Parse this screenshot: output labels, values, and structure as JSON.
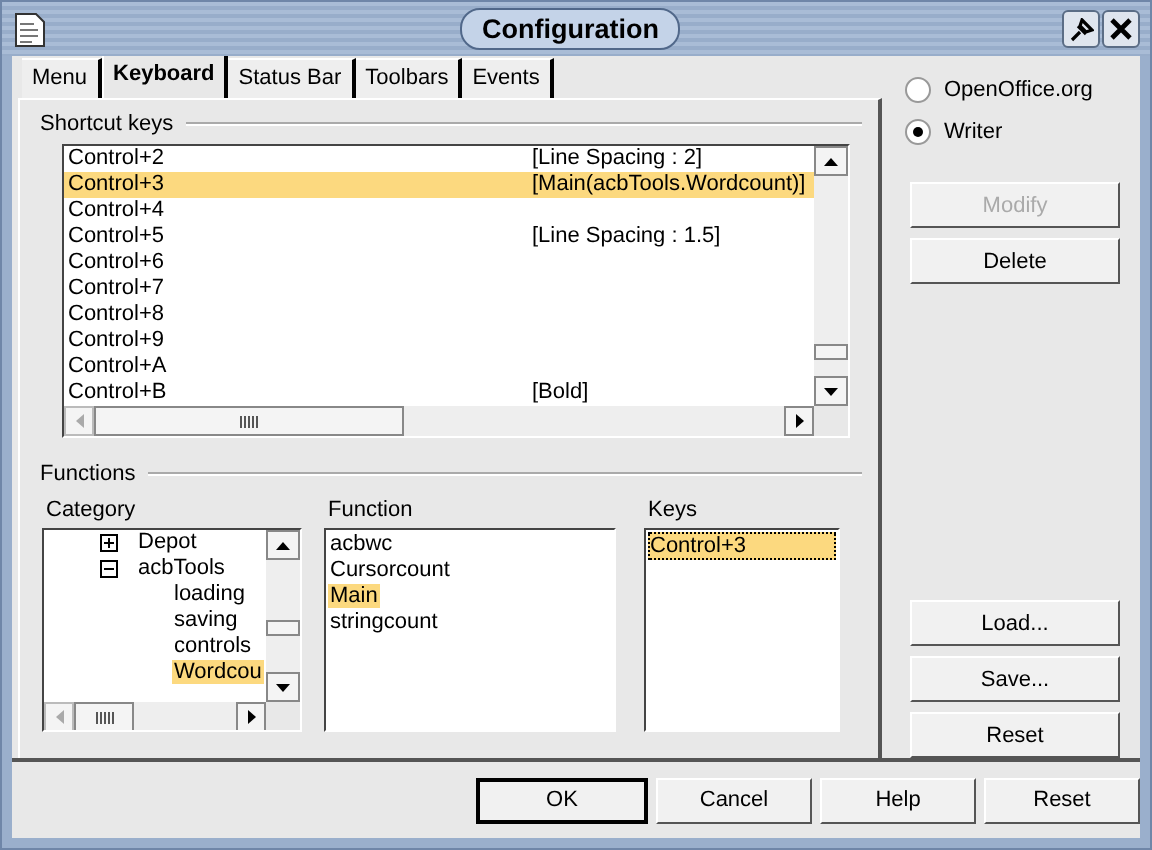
{
  "window": {
    "title": "Configuration"
  },
  "tabs": [
    {
      "label": "Menu",
      "selected": false
    },
    {
      "label": "Keyboard",
      "selected": true
    },
    {
      "label": "Status Bar",
      "selected": false
    },
    {
      "label": "Toolbars",
      "selected": false
    },
    {
      "label": "Events",
      "selected": false
    }
  ],
  "shortcut_keys": {
    "label": "Shortcut keys",
    "rows": [
      {
        "key": "Control+2",
        "command": "[Line Spacing : 2]",
        "selected": false
      },
      {
        "key": "Control+3",
        "command": "[Main(acbTools.Wordcount)]",
        "selected": true
      },
      {
        "key": "Control+4",
        "selected": false
      },
      {
        "key": "Control+5",
        "command": "[Line Spacing : 1.5]",
        "selected": false
      },
      {
        "key": "Control+6",
        "selected": false
      },
      {
        "key": "Control+7",
        "selected": false
      },
      {
        "key": "Control+8",
        "selected": false
      },
      {
        "key": "Control+9",
        "selected": false
      },
      {
        "key": "Control+A",
        "selected": false
      },
      {
        "key": "Control+B",
        "command": "[Bold]",
        "selected": false
      }
    ]
  },
  "scope": [
    {
      "label": "OpenOffice.org",
      "selected": false
    },
    {
      "label": "Writer",
      "selected": true
    }
  ],
  "side_buttons_top": [
    {
      "label": "Modify",
      "disabled": true
    },
    {
      "label": "Delete",
      "disabled": false
    }
  ],
  "functions": {
    "label": "Functions",
    "category": {
      "label": "Category",
      "tree": [
        {
          "label": "Depot",
          "expanded": false,
          "selected": false
        },
        {
          "label": "acbTools",
          "expanded": true,
          "selected": false,
          "children": [
            {
              "label": "loading",
              "selected": false
            },
            {
              "label": "saving",
              "selected": false
            },
            {
              "label": "controls",
              "selected": false
            },
            {
              "label": "Wordcou",
              "selected": true
            }
          ]
        }
      ]
    },
    "function": {
      "label": "Function",
      "items": [
        {
          "label": "acbwc",
          "selected": false
        },
        {
          "label": "Cursorcount",
          "selected": false
        },
        {
          "label": "Main",
          "selected": true
        },
        {
          "label": "stringcount",
          "selected": false
        }
      ]
    },
    "keys": {
      "label": "Keys",
      "items": [
        {
          "label": "Control+3",
          "selected": true
        }
      ]
    }
  },
  "side_buttons_bottom": [
    {
      "label": "Load...",
      "disabled": false
    },
    {
      "label": "Save...",
      "disabled": false
    },
    {
      "label": "Reset",
      "disabled": false
    }
  ],
  "footer_buttons": [
    {
      "label": "OK",
      "default": true
    },
    {
      "label": "Cancel",
      "default": false
    },
    {
      "label": "Help",
      "default": false
    },
    {
      "label": "Reset",
      "default": false
    }
  ]
}
